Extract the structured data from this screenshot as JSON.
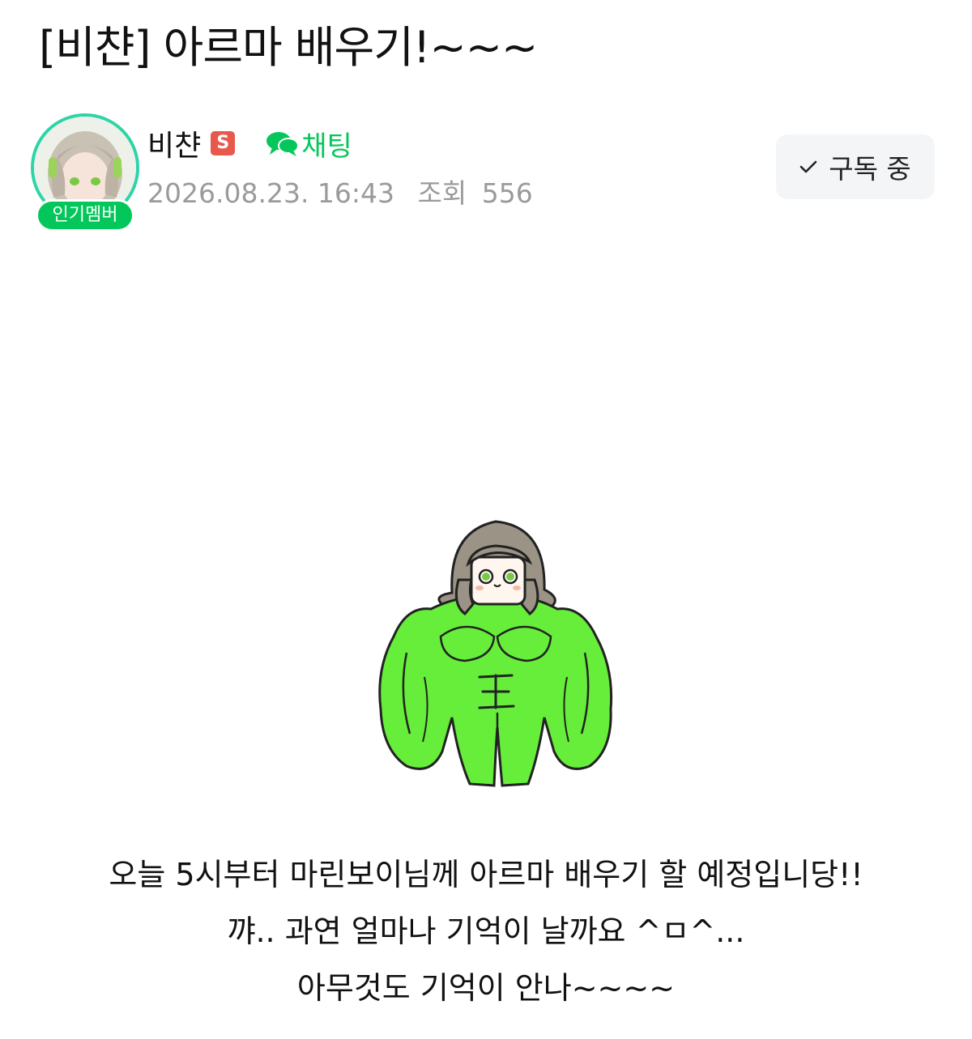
{
  "post": {
    "title": "[비챤] 아르마 배우기!~~~"
  },
  "author": {
    "name": "비챤",
    "staff_badge": "S",
    "member_badge": "인기멤버",
    "chat_label": "채팅",
    "avatar_icon": "avatar-image"
  },
  "meta": {
    "datetime": "2026.08.23. 16:43",
    "views_label": "조회",
    "views_count": "556"
  },
  "subscribe": {
    "label": "구독 중"
  },
  "content": {
    "image_icon": "muscle-character-image",
    "lines": [
      "오늘 5시부터 마린보이님께 아르마 배우기 할 예정입니당!!",
      "꺄.. 과연 얼마나 기억이 날까요 ^ㅁ^...",
      "아무것도 기억이 안나~~~~"
    ]
  },
  "colors": {
    "accent_green": "#03c75a",
    "ring_teal": "#2dd4a6",
    "staff_red": "#e8584d",
    "muscle_green": "#66ee3a"
  }
}
